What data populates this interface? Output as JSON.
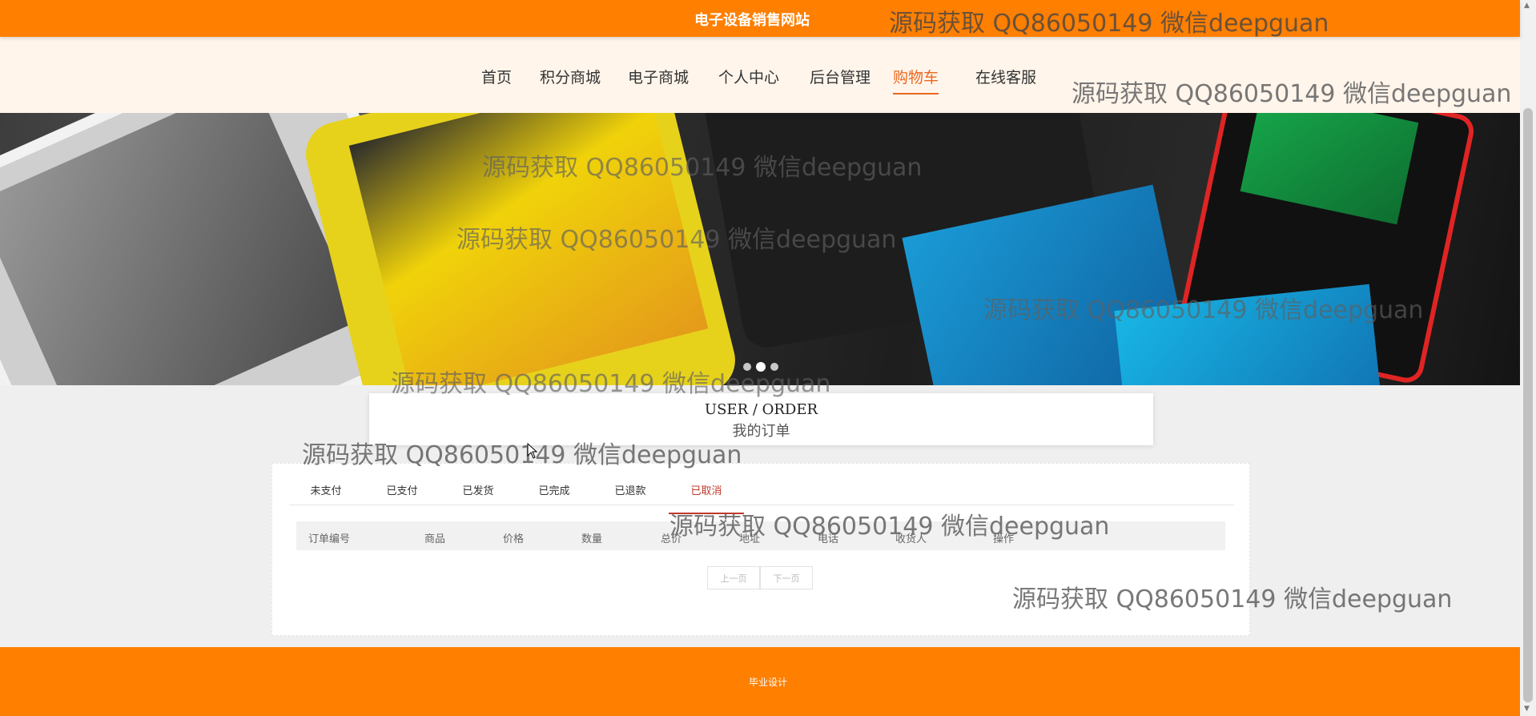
{
  "header": {
    "site_title": "电子设备销售网站"
  },
  "nav": {
    "items": [
      {
        "label": "首页",
        "active": false
      },
      {
        "label": "积分商城",
        "active": false
      },
      {
        "label": "电子商城",
        "active": false
      },
      {
        "label": "个人中心",
        "active": false
      },
      {
        "label": "后台管理",
        "active": false
      },
      {
        "label": "购物车",
        "active": true
      },
      {
        "label": "在线客服",
        "active": false
      }
    ]
  },
  "banner": {
    "dots": 3,
    "active_dot": 2
  },
  "section": {
    "title_en": "USER / ORDER",
    "title_cn": "我的订单"
  },
  "orders": {
    "tabs": [
      {
        "label": "未支付",
        "active": false
      },
      {
        "label": "已支付",
        "active": false
      },
      {
        "label": "已发货",
        "active": false
      },
      {
        "label": "已完成",
        "active": false
      },
      {
        "label": "已退款",
        "active": false
      },
      {
        "label": "已取消",
        "active": true
      }
    ],
    "columns": [
      "订单编号",
      "商品",
      "价格",
      "数量",
      "总价",
      "地址",
      "电话",
      "收货人",
      "操作"
    ],
    "rows": [],
    "pagination": {
      "prev": "上一页",
      "next": "下一页"
    }
  },
  "footer": {
    "text": "毕业设计"
  },
  "watermark": {
    "text": "源码获取 QQ86050149 微信deepguan"
  },
  "colors": {
    "primary": "#ff7f00",
    "nav_bg": "#fff5eb",
    "active_nav": "#e9681f",
    "active_tab": "#c0392b"
  }
}
